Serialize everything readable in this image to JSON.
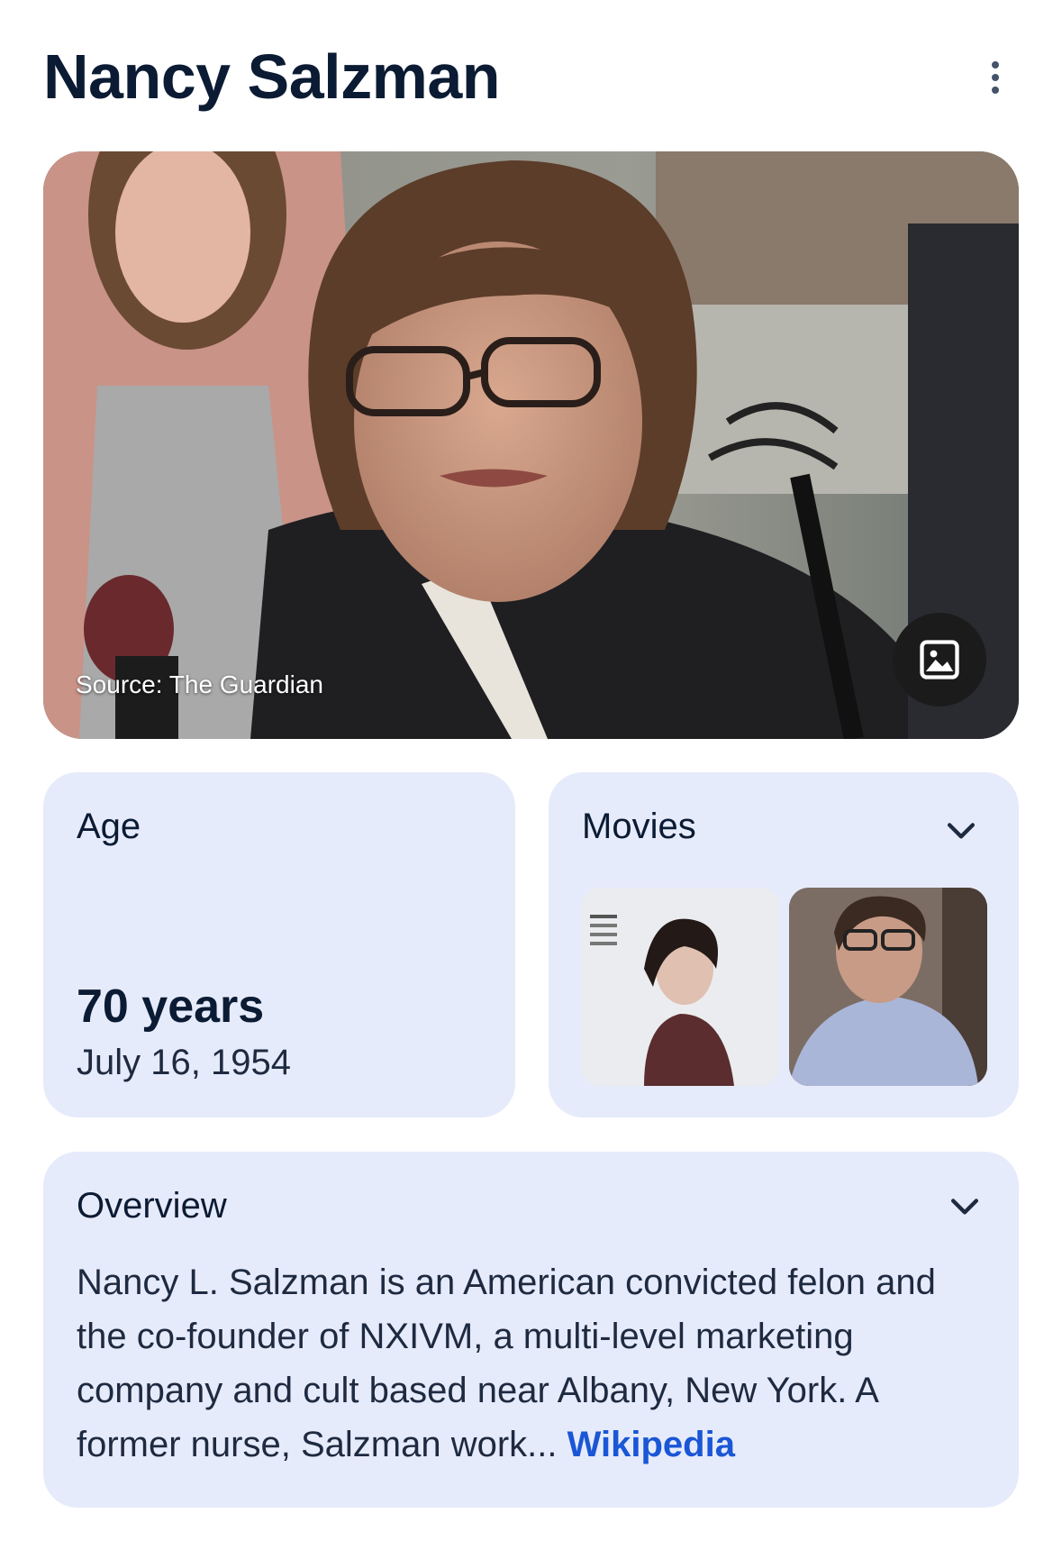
{
  "header": {
    "title": "Nancy Salzman",
    "more_icon": "more-vert-icon"
  },
  "hero": {
    "source_caption": "Source: The Guardian",
    "image_button_icon": "image-icon"
  },
  "age_card": {
    "label": "Age",
    "value": "70 years",
    "date": "July 16, 1954"
  },
  "movies_card": {
    "label": "Movies",
    "expand_icon": "chevron-down-icon"
  },
  "overview_card": {
    "label": "Overview",
    "text": "Nancy L. Salzman is an American convicted felon and the co-founder of NXIVM, a multi-level marketing company and cult based near Albany, New York. A former nurse, Salzman work",
    "ellipsis": "...",
    "link": "Wikipedia",
    "expand_icon": "chevron-down-icon"
  },
  "colors": {
    "card_bg": "#e6ebfb",
    "title_text": "#0b1b33",
    "link": "#1a56d6"
  }
}
